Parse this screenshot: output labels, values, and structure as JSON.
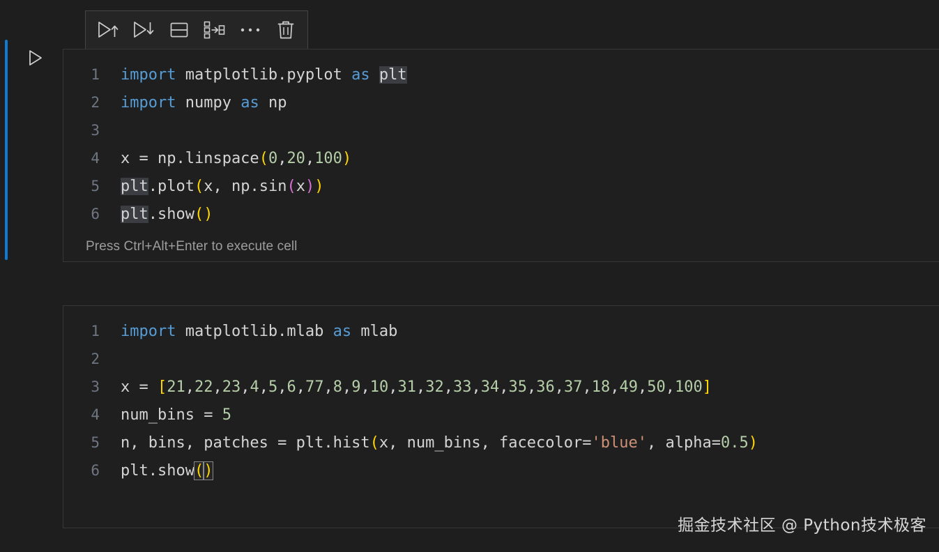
{
  "theme": {
    "editor_background": "#1e1e1e",
    "cell_background": "#1f1f1f",
    "cell_border": "#37373a",
    "toolbar_background": "#252526",
    "toolbar_border": "#454545",
    "active_cell_bar": "#0f7ad1",
    "line_number": "#6e7681",
    "foreground": "#d4d4d4",
    "keyword": "#569cd6",
    "number": "#b5cea8",
    "string": "#ce9178",
    "bracket_level_1": "#ffd700",
    "bracket_level_2": "#da70d6",
    "selection_highlight": "#3a3d41"
  },
  "gutter": {
    "run_cell_icon": "play-triangle-outline-icon",
    "active_cell_indicator": "active-cell-bar"
  },
  "toolbar": {
    "buttons": [
      {
        "name": "run-above-button",
        "icon": "play-arrow-up-icon",
        "tooltip": "Execute Above Cells"
      },
      {
        "name": "run-below-button",
        "icon": "play-arrow-down-icon",
        "tooltip": "Execute Cell and Below"
      },
      {
        "name": "split-cell-button",
        "icon": "split-cell-icon",
        "tooltip": "Split Cell"
      },
      {
        "name": "merge-cell-button",
        "icon": "merge-cell-icon",
        "tooltip": "Merge Cell"
      },
      {
        "name": "more-actions-button",
        "icon": "ellipsis-icon",
        "tooltip": "More Actions..."
      },
      {
        "name": "delete-cell-button",
        "icon": "trash-icon",
        "tooltip": "Delete Cell"
      }
    ]
  },
  "cells": [
    {
      "id": "cell-1",
      "language": "python",
      "execution_hint": "Press Ctrl+Alt+Enter to execute cell",
      "lines": [
        {
          "number": "1",
          "text": "import matplotlib.pyplot as plt"
        },
        {
          "number": "2",
          "text": "import numpy as np"
        },
        {
          "number": "3",
          "text": ""
        },
        {
          "number": "4",
          "text": "x = np.linspace(0,20,100)"
        },
        {
          "number": "5",
          "text": "plt.plot(x, np.sin(x))"
        },
        {
          "number": "6",
          "text": "plt.show()"
        }
      ]
    },
    {
      "id": "cell-2",
      "language": "python",
      "execution_hint": "",
      "lines": [
        {
          "number": "1",
          "text": "import matplotlib.mlab as mlab"
        },
        {
          "number": "2",
          "text": ""
        },
        {
          "number": "3",
          "text": "x = [21,22,23,4,5,6,77,8,9,10,31,32,33,34,35,36,37,18,49,50,100]"
        },
        {
          "number": "4",
          "text": "num_bins = 5"
        },
        {
          "number": "5",
          "text": "n, bins, patches = plt.hist(x, num_bins, facecolor='blue', alpha=0.5)"
        },
        {
          "number": "6",
          "text": "plt.show()"
        }
      ]
    }
  ],
  "watermark": {
    "text": "掘金技术社区 @ Python技术极客"
  }
}
